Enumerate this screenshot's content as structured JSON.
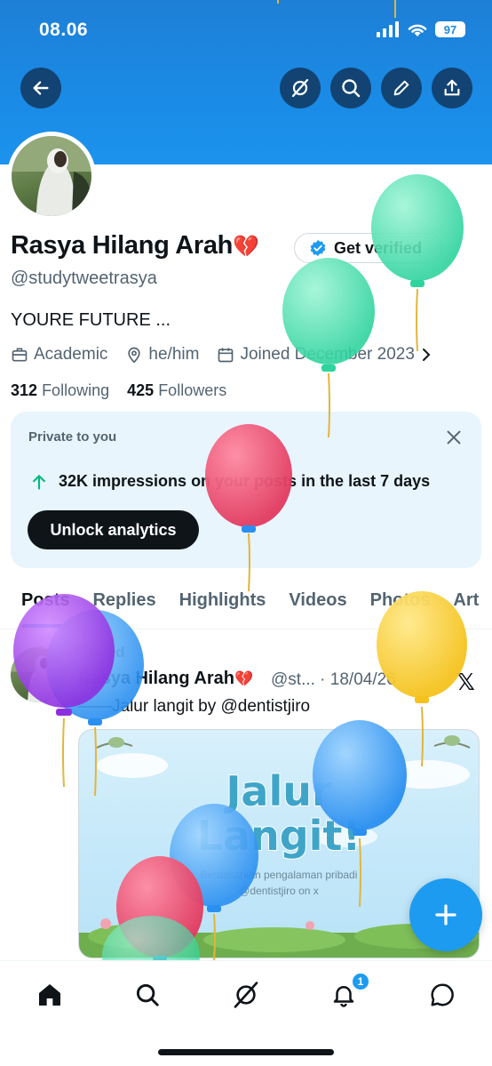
{
  "status": {
    "time": "08.06",
    "battery": "97"
  },
  "profile": {
    "name": "Rasya Hilang Arah",
    "name_emoji": "💔",
    "get_verified": "Get verified",
    "handle": "@studytweetrasya",
    "bio": "YOURE FUTURE ...",
    "category": "Academic",
    "pronouns": "he/him",
    "joined": "Joined December 2023",
    "following_count": "312",
    "following_label": "Following",
    "followers_count": "425",
    "followers_label": "Followers"
  },
  "private_card": {
    "title": "Private to you",
    "impressions": "32K impressions on your posts in the last 7 days",
    "button": "Unlock analytics"
  },
  "tabs": [
    "Posts",
    "Replies",
    "Highlights",
    "Videos",
    "Photos",
    "Art"
  ],
  "post": {
    "pinned_label": "Pinned",
    "author": "Rasya Hilang Arah",
    "author_emoji": "💔",
    "handle_date": "@st... · 18/04/26",
    "text": "——Jalur langit by @dentistjiro",
    "media": {
      "title_line1": "Jalur",
      "title_line2": "Langit!",
      "subtitle": "Berdasarkan pengalaman pribadi",
      "credit": "@dentistjiro on x"
    }
  },
  "bottom_nav": {
    "notifications_badge": "1"
  },
  "colors": {
    "accent": "#1d9bf0",
    "header": "#1a8be6",
    "text": "#0f1419",
    "muted": "#536471",
    "card": "#e8f5fd"
  },
  "icons": [
    "back-arrow-icon",
    "grok-icon",
    "search-icon",
    "edit-pencil-icon",
    "share-icon",
    "verified-badge-icon",
    "briefcase-icon",
    "location-icon",
    "calendar-icon",
    "chevron-right-icon",
    "close-icon",
    "arrow-up-icon",
    "pin-icon",
    "x-logo-icon",
    "plus-icon",
    "home-icon",
    "notification-bell-icon",
    "messages-icon"
  ]
}
